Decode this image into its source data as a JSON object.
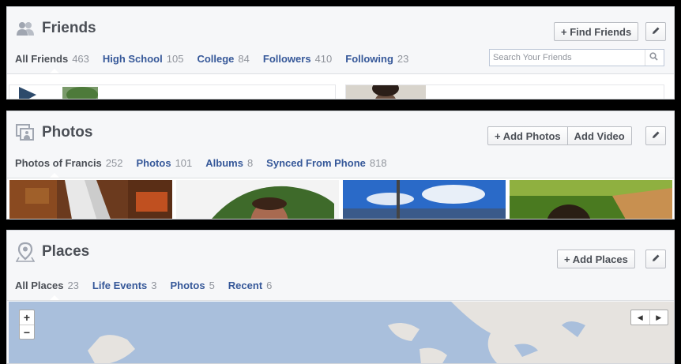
{
  "friends": {
    "title": "Friends",
    "find_friends_label": "+ Find Friends",
    "tabs": [
      {
        "label": "All Friends",
        "count": "463"
      },
      {
        "label": "High School",
        "count": "105"
      },
      {
        "label": "College",
        "count": "84"
      },
      {
        "label": "Followers",
        "count": "410"
      },
      {
        "label": "Following",
        "count": "23"
      }
    ],
    "search_placeholder": "Search Your Friends"
  },
  "photos": {
    "title": "Photos",
    "add_photos_label": "+ Add Photos",
    "add_video_label": "Add Video",
    "tabs": [
      {
        "label": "Photos of Francis",
        "count": "252"
      },
      {
        "label": "Photos",
        "count": "101"
      },
      {
        "label": "Albums",
        "count": "8"
      },
      {
        "label": "Synced From Phone",
        "count": "818"
      }
    ]
  },
  "places": {
    "title": "Places",
    "add_places_label": "+ Add Places",
    "tabs": [
      {
        "label": "All Places",
        "count": "23"
      },
      {
        "label": "Life Events",
        "count": "3"
      },
      {
        "label": "Photos",
        "count": "5"
      },
      {
        "label": "Recent",
        "count": "6"
      }
    ],
    "zoom_in": "+",
    "zoom_out": "−",
    "prev": "◀",
    "next": "▶"
  },
  "colors": {
    "link": "#365899",
    "text_dark": "#4b4f56",
    "count_gray": "#90949c",
    "map_water": "#a9bfdc"
  },
  "icons": [
    "friends-icon",
    "photos-icon",
    "places-icon",
    "pencil-icon",
    "search-icon"
  ]
}
